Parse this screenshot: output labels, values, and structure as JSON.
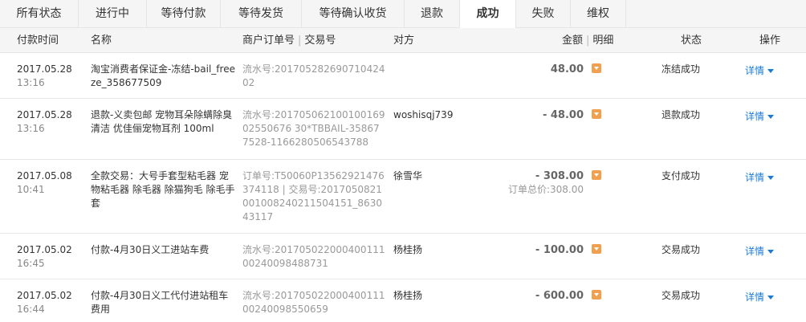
{
  "tabs": [
    {
      "label": "所有状态"
    },
    {
      "label": "进行中"
    },
    {
      "label": "等待付款"
    },
    {
      "label": "等待发货"
    },
    {
      "label": "等待确认收货"
    },
    {
      "label": "退款"
    },
    {
      "label": "成功"
    },
    {
      "label": "失败"
    },
    {
      "label": "维权"
    }
  ],
  "active_tab": "成功",
  "header": {
    "date": "付款时间",
    "name": "名称",
    "order": "商户订单号",
    "trade": "交易号",
    "party": "对方",
    "amount": "金额",
    "detail": "明细",
    "status": "状态",
    "op": "操作"
  },
  "rows": [
    {
      "date": "2017.05.28",
      "time": "13:16",
      "name": "淘宝消费者保证金-冻结-bail_freeze_358677509",
      "order": "流水号:20170528269071042402",
      "party": "",
      "amount": "48.00",
      "sub": "",
      "status": "冻结成功",
      "op": "详情"
    },
    {
      "date": "2017.05.28",
      "time": "13:16",
      "name": "退款-义卖包邮 宠物耳朵除螨除臭清洁 优佳俪宠物耳剂 100ml",
      "order": "流水号:20170506210010016902550676 30*TBBAIL-358677528-1166280506543788",
      "party": "woshisqj739",
      "amount": "- 48.00",
      "sub": "",
      "status": "退款成功",
      "op": "详情"
    },
    {
      "date": "2017.05.08",
      "time": "10:41",
      "name": "全款交易：大号手套型粘毛器 宠物粘毛器 除毛器 除猫狗毛 除毛手套",
      "order": "订单号:T50060P13562921476374118 | 交易号:2017050821001008240211504151_863043117",
      "party": "徐雪华",
      "amount": "- 308.00",
      "sub": "订单总价:308.00",
      "status": "支付成功",
      "op": "详情"
    },
    {
      "date": "2017.05.02",
      "time": "16:45",
      "name": "付款-4月30日义工进站车费",
      "order": "流水号:20170502200040011100240098488731",
      "party": "杨桂扬",
      "amount": "- 100.00",
      "sub": "",
      "status": "交易成功",
      "op": "详情"
    },
    {
      "date": "2017.05.02",
      "time": "16:44",
      "name": "付款-4月30日义工代付进站租车费用",
      "order": "流水号:20170502200040011100240098550659",
      "party": "杨桂扬",
      "amount": "- 600.00",
      "sub": "",
      "status": "交易成功",
      "op": "详情"
    }
  ]
}
